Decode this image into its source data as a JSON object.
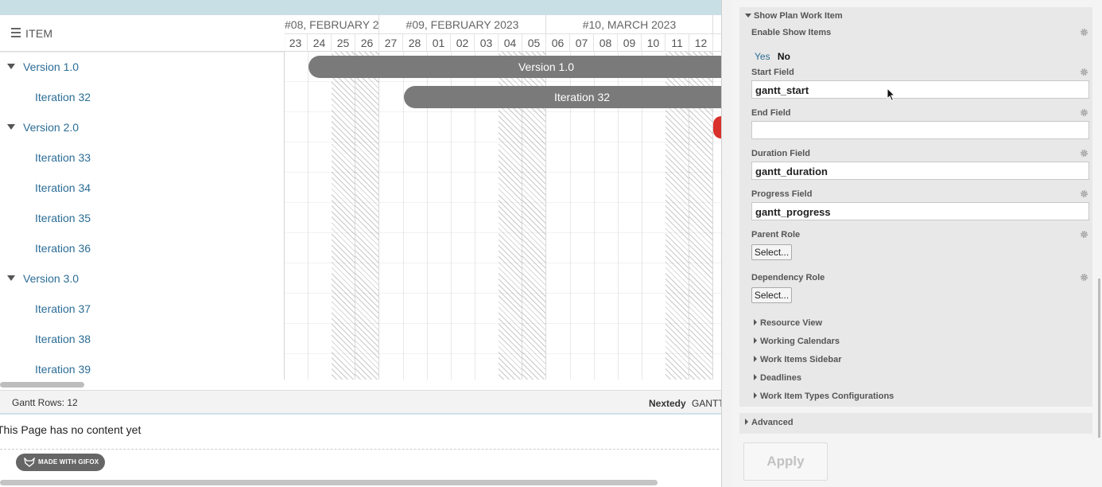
{
  "grid": {
    "column_label": "ITEM",
    "rows": [
      {
        "label": "Version 1.0",
        "level": 0,
        "expanded": true
      },
      {
        "label": "Iteration 32",
        "level": 1
      },
      {
        "label": "Version 2.0",
        "level": 0,
        "expanded": true
      },
      {
        "label": "Iteration 33",
        "level": 1
      },
      {
        "label": "Iteration 34",
        "level": 1
      },
      {
        "label": "Iteration 35",
        "level": 1
      },
      {
        "label": "Iteration 36",
        "level": 1
      },
      {
        "label": "Version 3.0",
        "level": 0,
        "expanded": true
      },
      {
        "label": "Iteration 37",
        "level": 1
      },
      {
        "label": "Iteration 38",
        "level": 1
      },
      {
        "label": "Iteration 39",
        "level": 1
      }
    ]
  },
  "timeline": {
    "weeks": [
      "#08, FEBRUARY 2",
      "#09, FEBRUARY 2023",
      "#10, MARCH 2023"
    ],
    "days": [
      "23",
      "24",
      "25",
      "26",
      "27",
      "28",
      "01",
      "02",
      "03",
      "04",
      "05",
      "06",
      "07",
      "08",
      "09",
      "10",
      "11",
      "12"
    ],
    "bars": [
      {
        "label": "Version 1.0",
        "row": 0,
        "start_day": "24"
      },
      {
        "label": "Iteration 32",
        "row": 1,
        "start_day": "28"
      }
    ],
    "accent_color": "#d9302c"
  },
  "footer": {
    "gantt_rows": "Gantt Rows: 12",
    "brand": "Nextedy",
    "product": "GANTT"
  },
  "page_message": "This Page has no content yet",
  "gifox_badge": "MADE WITH GIFOX",
  "panel": {
    "section_title": "Show Plan Work Item",
    "enable_label": "Enable Show Items",
    "yes": "Yes",
    "no": "No",
    "start_field_label": "Start Field",
    "start_field_value": "gantt_start",
    "end_field_label": "End Field",
    "end_field_value": "",
    "duration_field_label": "Duration Field",
    "duration_field_value": "gantt_duration",
    "progress_field_label": "Progress Field",
    "progress_field_value": "gantt_progress",
    "parent_role_label": "Parent Role",
    "parent_role_button": "Select...",
    "dependency_role_label": "Dependency Role",
    "dependency_role_button": "Select...",
    "subsections": [
      "Resource View",
      "Working Calendars",
      "Work Items Sidebar",
      "Deadlines",
      "Work Item Types Configurations"
    ],
    "advanced": "Advanced",
    "apply": "Apply"
  }
}
